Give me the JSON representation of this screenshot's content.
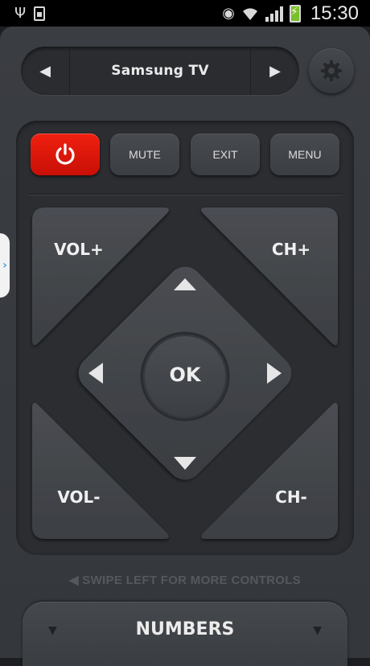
{
  "status_bar": {
    "time": "15:30",
    "usb_icon": "usb-icon",
    "sd_icon": "sd-card-icon",
    "eye_icon": "eye-icon",
    "wifi_icon": "wifi-icon",
    "signal_icon": "signal-icon",
    "battery_icon": "battery-charging-icon"
  },
  "device_selector": {
    "name": "Samsung TV",
    "prev_glyph": "◀",
    "next_glyph": "▶"
  },
  "top_buttons": {
    "mute": "MUTE",
    "exit": "EXIT",
    "menu": "MENU"
  },
  "pad": {
    "vol_up": "VOL+",
    "vol_down": "VOL-",
    "ch_up": "CH+",
    "ch_down": "CH-",
    "ok": "OK"
  },
  "side_tab_glyph": "›",
  "swipe_hint": "◀ SWIPE LEFT FOR MORE CONTROLS",
  "numbers_panel": {
    "label": "NUMBERS",
    "arrow_glyph": "▼"
  },
  "colors": {
    "power_red": "#e8160a",
    "panel_dark": "#2b2d31",
    "button_gray": "#43464b",
    "battery_green": "#7bbf2a",
    "side_tab_accent": "#3ea6e0"
  }
}
